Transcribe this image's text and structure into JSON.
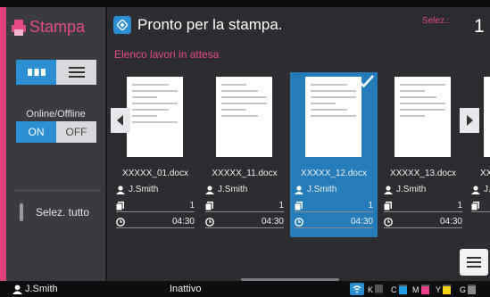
{
  "sidebar": {
    "title": "Stampa",
    "online_offline_label": "Online/Offline",
    "on_label": "ON",
    "off_label": "OFF",
    "select_all_label": "Selez. tutto"
  },
  "header": {
    "status": "Pronto per la stampa.",
    "selected_label": "Selez.:",
    "selected_count": "1"
  },
  "queue": {
    "title": "Elenco lavori in attesa",
    "jobs": [
      {
        "file": "XXXXX_01.docx",
        "user": "J.Smith",
        "copies": "1",
        "time": "04:30",
        "selected": false
      },
      {
        "file": "XXXXX_11.docx",
        "user": "J.Smith",
        "copies": "1",
        "time": "04:30",
        "selected": false
      },
      {
        "file": "XXXXX_12.docx",
        "user": "J.Smith",
        "copies": "1",
        "time": "04:30",
        "selected": true
      },
      {
        "file": "XXXXX_13.docx",
        "user": "J.Smith",
        "copies": "1",
        "time": "04:30",
        "selected": false
      },
      {
        "file": "XX",
        "user": "J.",
        "copies": "1",
        "time": "",
        "selected": false
      }
    ]
  },
  "footer": {
    "user": "J.Smith",
    "status": "Inattivo",
    "inks": [
      {
        "label": "K",
        "color": "#222222",
        "level": 0.15
      },
      {
        "label": "C",
        "color": "#1ea0e6",
        "level": 0.85
      },
      {
        "label": "M",
        "color": "#e83e8c",
        "level": 0.85
      },
      {
        "label": "Y",
        "color": "#f3d21a",
        "level": 0.85
      },
      {
        "label": "G",
        "color": "#8a8a8a",
        "level": 0.85
      }
    ]
  },
  "colors": {
    "accent": "#2b8fd1",
    "brand": "#e84a86"
  },
  "icons": [
    "print-icon",
    "grid-view-icon",
    "list-view-icon",
    "info-icon",
    "check-icon",
    "arrow-left-icon",
    "arrow-right-icon",
    "user-icon",
    "copies-icon",
    "clock-icon",
    "menu-icon",
    "wifi-icon"
  ]
}
